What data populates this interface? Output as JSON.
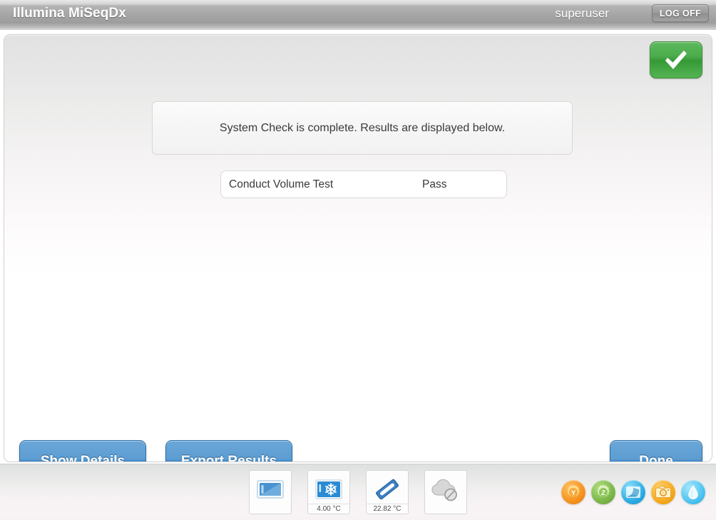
{
  "titlebar": {
    "app_title": "Illumina MiSeqDx",
    "user": "superuser",
    "logoff_label": "LOG OFF"
  },
  "main": {
    "status_icon": "check-icon",
    "message": "System Check is complete. Results are displayed below.",
    "results": [
      {
        "label": "Conduct Volume Test",
        "value": "Pass"
      }
    ]
  },
  "buttons": {
    "show_details": "Show Details",
    "export_results": "Export Results",
    "done": "Done"
  },
  "statusbar": {
    "tiles": [
      {
        "icon": "flow-cell-icon",
        "temp": ""
      },
      {
        "icon": "snowflake-icon",
        "temp": "4.00 °C"
      },
      {
        "icon": "slide-icon",
        "temp": "22.82 °C"
      },
      {
        "icon": "cloud-disabled-icon",
        "temp": ""
      }
    ],
    "sensors": [
      {
        "icon": "gear-y-icon",
        "label": "Y",
        "color": "#f5921e"
      },
      {
        "icon": "gear-z-icon",
        "label": "Z",
        "color": "#7ab648"
      },
      {
        "icon": "flow-cell-scan-icon",
        "label": "",
        "color": "#29abe2"
      },
      {
        "icon": "camera-icon",
        "label": "",
        "color": "#f5a81c"
      },
      {
        "icon": "fluidics-drop-icon",
        "label": "",
        "color": "#4cc3f0"
      }
    ]
  },
  "colors": {
    "accent_blue": "#3f86c4",
    "success_green": "#4cae4c",
    "titlebar_gray": "#a6a6a6"
  }
}
